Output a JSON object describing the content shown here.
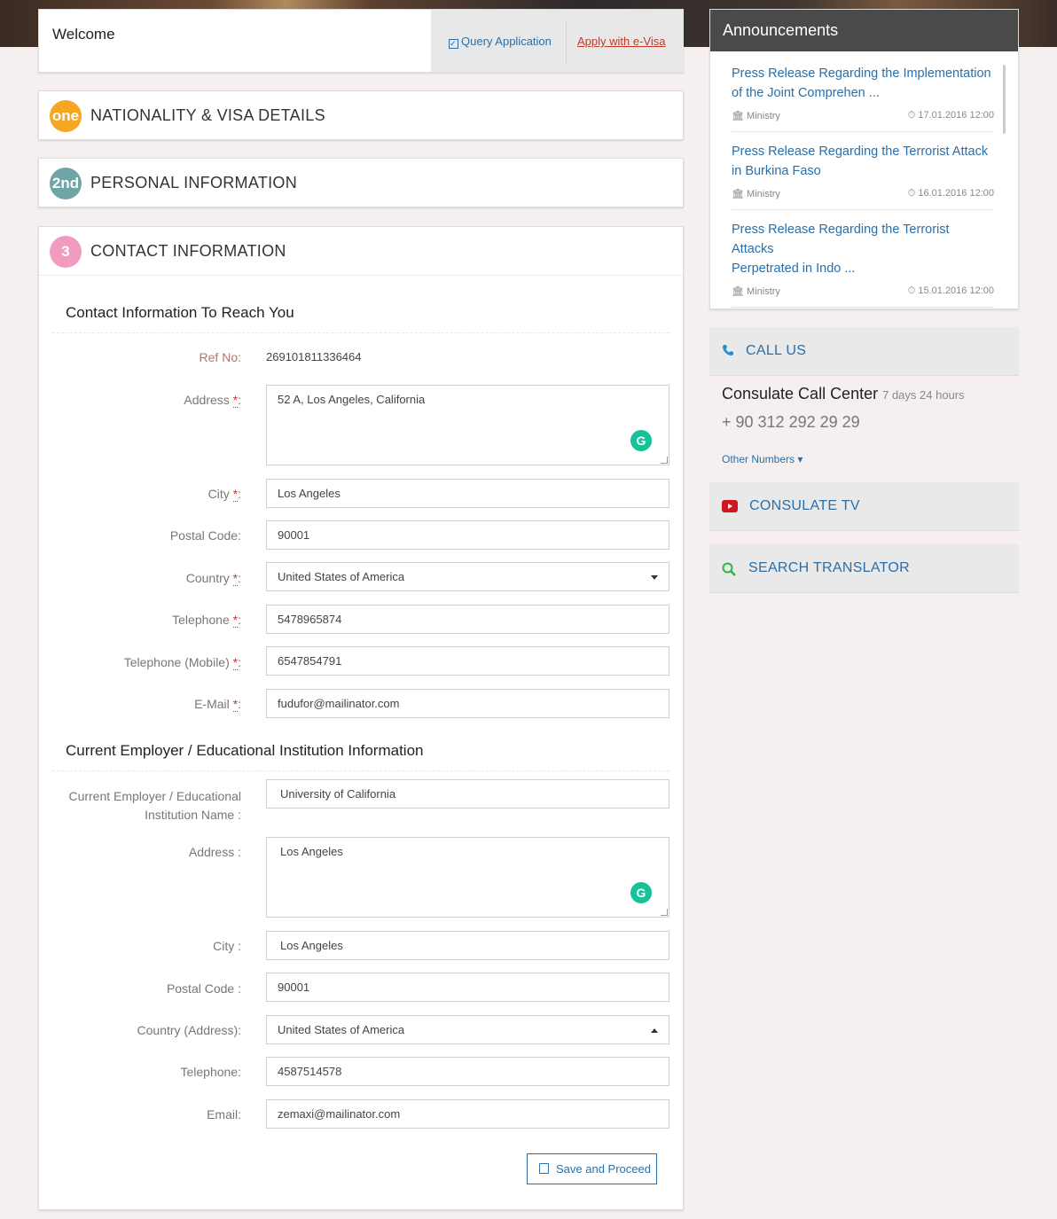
{
  "header": {
    "welcome": "Welcome",
    "query_application": "Query Application",
    "apply_evisa": "Apply with e-Visa"
  },
  "sections": [
    {
      "badge": "one",
      "title": "NATIONALITY & VISA DETAILS",
      "color": "#f5a623"
    },
    {
      "badge": "2nd",
      "title": "PERSONAL INFORMATION",
      "color": "#6ea5a8"
    },
    {
      "badge": "3",
      "title": "CONTACT INFORMATION",
      "color": "#f29bc0"
    }
  ],
  "contact": {
    "heading": "Contact Information To Reach You",
    "ref_no_label": "Ref No:",
    "ref_no": "269101811336464",
    "address_label": "Address",
    "address": "52 A, Los Angeles, California",
    "city_label": "City",
    "city": "Los Angeles",
    "postal_label": "Postal Code:",
    "postal": "90001",
    "country_label": "Country",
    "country": "United States of America",
    "telephone_label": "Telephone",
    "telephone": "5478965874",
    "mobile_label": "Telephone (Mobile)",
    "mobile": "6547854791",
    "email_label": "E-Mail",
    "email": "fudufor@mailinator.com"
  },
  "employer": {
    "heading": "Current Employer / Educational Institution Information",
    "name_label_1": "Current Employer / Educational",
    "name_label_2": "Institution Name :",
    "name": "University of California",
    "address_label": "Address :",
    "address": "Los Angeles",
    "city_label": "City :",
    "city": "Los Angeles",
    "postal_label": "Postal Code :",
    "postal": "90001",
    "country_label": "Country (Address):",
    "country": "United States of America",
    "telephone_label": "Telephone:",
    "telephone": "4587514578",
    "email_label": "Email:",
    "email": "zemaxi@mailinator.com"
  },
  "save_button": "Save and Proceed",
  "announcements": {
    "title": "Announcements",
    "items": [
      {
        "line1": "Press Release Regarding the Implementation",
        "line2": "of the Joint Comprehen ...",
        "source": "Ministry",
        "date": "17.01.2016 12:00"
      },
      {
        "line1": "Press Release Regarding the Terrorist Attack",
        "line2": "in Burkina Faso",
        "source": "Ministry",
        "date": "16.01.2016 12:00"
      },
      {
        "line1": "Press Release Regarding the Terrorist Attacks",
        "line2": "Perpetrated in Indo ...",
        "source": "Ministry",
        "date": "15.01.2016 12:00"
      }
    ]
  },
  "call_us": {
    "title": "CALL US",
    "center": "Consulate Call Center",
    "hours": "7 days 24 hours",
    "phone": "+ 90 312 292 29 29",
    "other_numbers": "Other Numbers"
  },
  "consulate_tv": "CONSULATE TV",
  "search_translator": "SEARCH TRANSLATOR"
}
